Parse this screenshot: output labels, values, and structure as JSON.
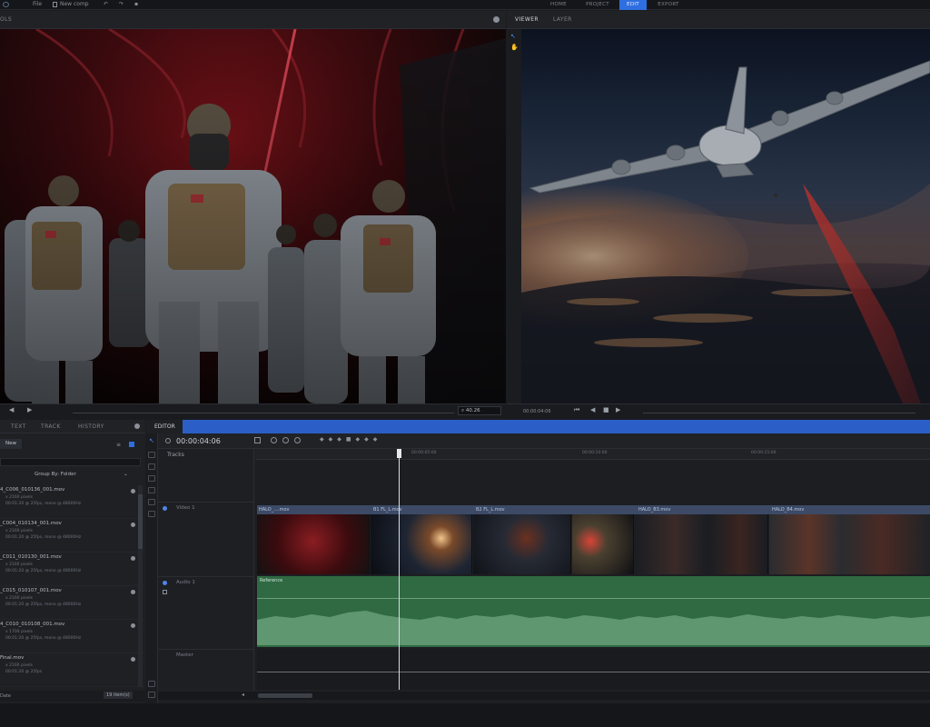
{
  "menu": {
    "file_label": "File",
    "new_comp_label": "New comp",
    "undo_icon": "undo-icon",
    "redo_icon": "redo-icon"
  },
  "workspace_tabs": [
    {
      "label": "HOME",
      "active": false
    },
    {
      "label": "PROJECT",
      "active": false
    },
    {
      "label": "EDIT",
      "active": true
    },
    {
      "label": "EXPORT",
      "active": false
    }
  ],
  "left_viewer": {
    "tab_label": "OLS",
    "zoom": "40.26"
  },
  "right_viewer": {
    "tabs": [
      {
        "label": "VIEWER",
        "active": true
      },
      {
        "label": "LAYER",
        "active": false
      }
    ],
    "timecode": "00:00:04:06"
  },
  "media_panel": {
    "tabs": [
      {
        "label": "TEXT",
        "active": false
      },
      {
        "label": "TRACK",
        "active": false
      },
      {
        "label": "HISTORY",
        "active": false
      }
    ],
    "new_label": "New",
    "group_by_label": "Group By: Folder",
    "items": [
      {
        "name": "4_C006_010136_001.mov",
        "res": "x 2160 pixels",
        "info": "00:01:20 @ 25fps, mono @ 48000Hz"
      },
      {
        "name": "_C004_010134_001.mov",
        "res": "x 2160 pixels",
        "info": "00:01:20 @ 25fps, mono @ 48000Hz"
      },
      {
        "name": "_C011_010130_001.mov",
        "res": "x 2160 pixels",
        "info": "00:01:20 @ 25fps, mono @ 48000Hz"
      },
      {
        "name": "_C015_010107_001.mov",
        "res": "x 2160 pixels",
        "info": "00:01:20 @ 25fps, mono @ 48000Hz"
      },
      {
        "name": "4_C010_010108_001.mov",
        "res": "x 1700 pixels",
        "info": "00:01:20 @ 25fps, mono @ 48000Hz"
      },
      {
        "name": "Final.mov",
        "res": "x 2160 pixels",
        "info": "00:01:20 @ 25fps"
      }
    ],
    "footer_label": "Date",
    "item_count": "19 item(s)"
  },
  "editor": {
    "tab_label": "EDITOR",
    "timecode": "00:00:04:06",
    "tracks_label": "Tracks",
    "ruler_marks": [
      "00:00:05:00",
      "00:00:10:00",
      "00:00:15:00"
    ],
    "video_track_label": "Video 1",
    "audio_track_label": "Audio 1",
    "master_label": "Master",
    "audio_clip_label": "Reference",
    "clips": [
      {
        "label": "HALO_....mov"
      },
      {
        "label": "B1 FL_L.mov"
      },
      {
        "label": "B2 FL_L.mov"
      },
      {
        "label": "HALO_B3.mov"
      },
      {
        "label": "HALO_B4.mov"
      }
    ]
  },
  "colors": {
    "accent": "#2f6ee0",
    "audio_track": "#3a7a4c",
    "clip_header": "#3c4a66"
  }
}
